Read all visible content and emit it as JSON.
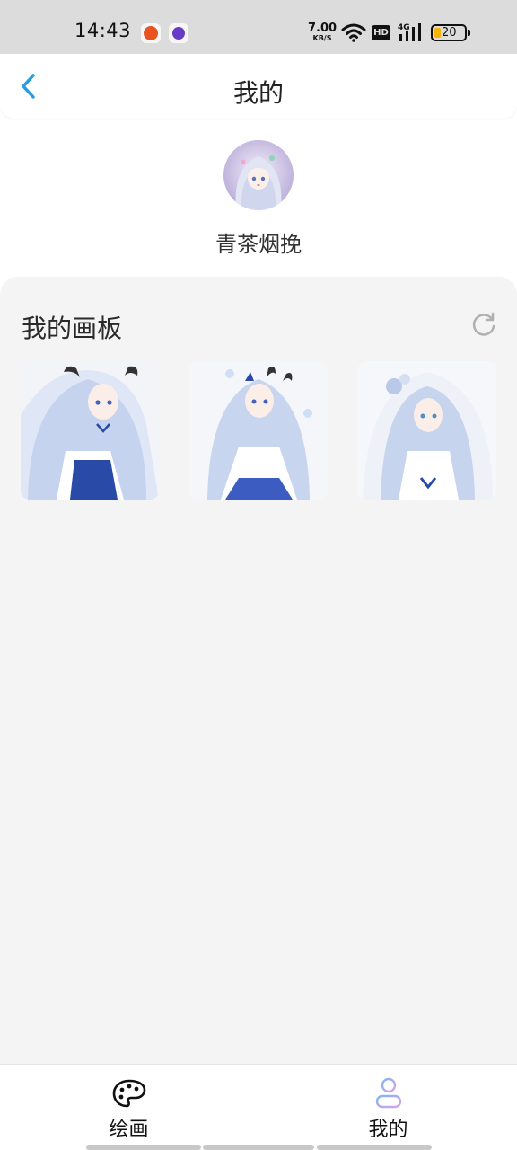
{
  "status_bar": {
    "time": "14:43",
    "net_speed_value": "7.00",
    "net_speed_unit": "KB/S",
    "hd_label": "HD",
    "signal_label": "4G",
    "battery_level": "20",
    "icons": [
      "app-notification-icon",
      "app-notification-icon",
      "wifi-icon",
      "hd-icon",
      "signal-icon",
      "battery-icon"
    ]
  },
  "header": {
    "title": "我的",
    "back_icon": "chevron-left-icon"
  },
  "profile": {
    "username": "青茶烟挽"
  },
  "board": {
    "title": "我的画板",
    "refresh_icon": "refresh-icon",
    "items_count": 3
  },
  "bottom_nav": {
    "items": [
      {
        "label": "绘画",
        "icon": "palette-icon",
        "active": false
      },
      {
        "label": "我的",
        "icon": "user-icon",
        "active": true
      }
    ]
  },
  "colors": {
    "accent": "#2a9be0",
    "board_bg": "#f4f4f4",
    "status_bar_bg": "#dcdcdc",
    "battery_fill": "#f5b400"
  }
}
